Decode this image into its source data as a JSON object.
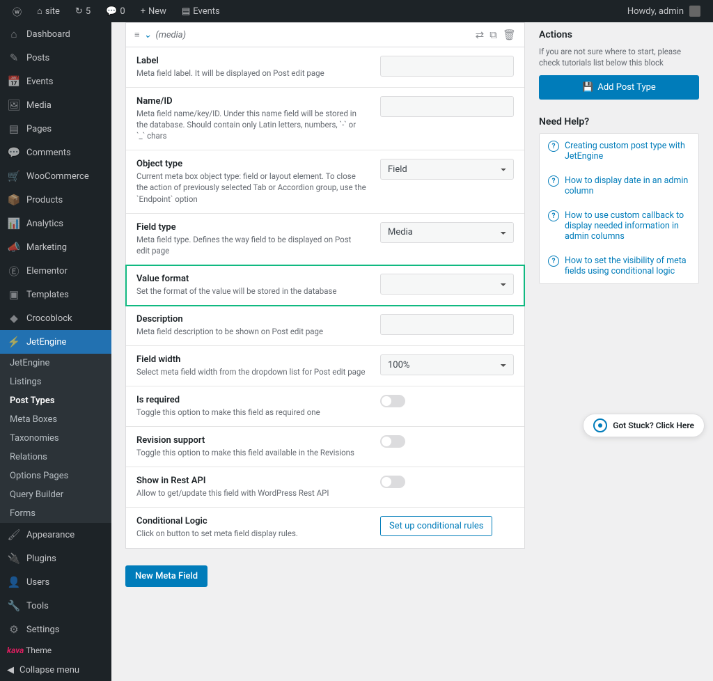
{
  "topbar": {
    "site": "site",
    "updates": "5",
    "comments": "0",
    "new": "New",
    "events": "Events",
    "howdy": "Howdy, admin"
  },
  "sidebar": {
    "items": [
      {
        "icon": "⌂",
        "label": "Dashboard"
      },
      {
        "icon": "✎",
        "label": "Posts"
      },
      {
        "icon": "📅",
        "label": "Events"
      },
      {
        "icon": "🖼",
        "label": "Media"
      },
      {
        "icon": "▤",
        "label": "Pages"
      },
      {
        "icon": "💬",
        "label": "Comments"
      },
      {
        "icon": "🛒",
        "label": "WooCommerce"
      },
      {
        "icon": "📦",
        "label": "Products"
      },
      {
        "icon": "📊",
        "label": "Analytics"
      },
      {
        "icon": "📣",
        "label": "Marketing"
      },
      {
        "icon": "Ⓔ",
        "label": "Elementor"
      },
      {
        "icon": "▣",
        "label": "Templates"
      },
      {
        "icon": "◆",
        "label": "Crocoblock"
      },
      {
        "icon": "⚡",
        "label": "JetEngine"
      }
    ],
    "sub": [
      "JetEngine",
      "Listings",
      "Post Types",
      "Meta Boxes",
      "Taxonomies",
      "Relations",
      "Options Pages",
      "Query Builder",
      "Forms"
    ],
    "bottom": [
      {
        "icon": "🖌",
        "label": "Appearance"
      },
      {
        "icon": "🔌",
        "label": "Plugins"
      },
      {
        "icon": "👤",
        "label": "Users"
      },
      {
        "icon": "🔧",
        "label": "Tools"
      },
      {
        "icon": "⚙",
        "label": "Settings"
      }
    ],
    "theme_brand": "kava",
    "theme_txt": "Theme",
    "collapse": "Collapse menu"
  },
  "breadcrumb": "(media)",
  "fields": {
    "label": {
      "title": "Label",
      "desc": "Meta field label. It will be displayed on Post edit page"
    },
    "nameid": {
      "title": "Name/ID",
      "desc": "Meta field name/key/ID. Under this name field will be stored in the database. Should contain only Latin letters, numbers, `-` or `_` chars"
    },
    "objtype": {
      "title": "Object type",
      "desc": "Current meta box object type: field or layout element. To close the action of previously selected Tab or Accordion group, use the `Endpoint` option",
      "value": "Field"
    },
    "fieldtype": {
      "title": "Field type",
      "desc": "Meta field type. Defines the way field to be displayed on Post edit page",
      "value": "Media"
    },
    "valueformat": {
      "title": "Value format",
      "desc": "Set the format of the value will be stored in the database"
    },
    "description": {
      "title": "Description",
      "desc": "Meta field description to be shown on Post edit page"
    },
    "fieldwidth": {
      "title": "Field width",
      "desc": "Select meta field width from the dropdown list for Post edit page",
      "value": "100%"
    },
    "required": {
      "title": "Is required",
      "desc": "Toggle this option to make this field as required one"
    },
    "revision": {
      "title": "Revision support",
      "desc": "Toggle this option to make this field available in the Revisions"
    },
    "restapi": {
      "title": "Show in Rest API",
      "desc": "Allow to get/update this field with WordPress Rest API"
    },
    "conditional": {
      "title": "Conditional Logic",
      "desc": "Click on button to set meta field display rules.",
      "button": "Set up conditional rules"
    }
  },
  "new_meta_btn": "New Meta Field",
  "actions": {
    "title": "Actions",
    "desc": "If you are not sure where to start, please check tutorials list below this block",
    "add_btn": "Add Post Type"
  },
  "help": {
    "title": "Need Help?",
    "items": [
      "Creating custom post type with JetEngine",
      "How to display date in an admin column",
      "How to use custom callback to display needed information in admin columns",
      "How to set the visibility of meta fields using conditional logic"
    ]
  },
  "stuck": "Got Stuck? Click Here"
}
